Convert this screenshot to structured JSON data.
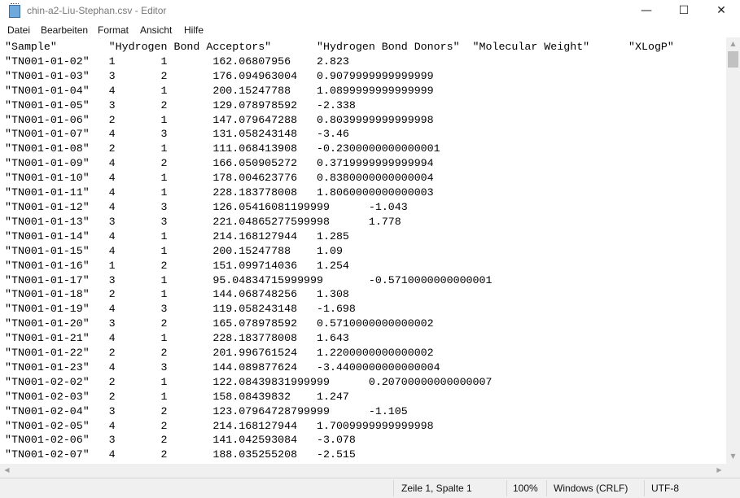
{
  "window": {
    "title": "chin-a2-Liu-Stephan.csv - Editor",
    "controls": {
      "minimize": "—",
      "maximize": "☐",
      "close": "✕"
    }
  },
  "menu": [
    "Datei",
    "Bearbeiten",
    "Format",
    "Ansicht",
    "Hilfe"
  ],
  "document": {
    "header": [
      "\"Sample\"",
      "\"Hydrogen Bond Acceptors\"",
      "\"Hydrogen Bond Donors\"",
      "\"Molecular Weight\"",
      "\"XLogP\""
    ],
    "rows": [
      [
        "\"TN001-01-02\"",
        "1",
        "1",
        "162.06807956",
        "2.823"
      ],
      [
        "\"TN001-01-03\"",
        "3",
        "2",
        "176.094963004",
        "0.9079999999999999"
      ],
      [
        "\"TN001-01-04\"",
        "4",
        "1",
        "200.15247788",
        "1.0899999999999999"
      ],
      [
        "\"TN001-01-05\"",
        "3",
        "2",
        "129.078978592",
        "-2.338"
      ],
      [
        "\"TN001-01-06\"",
        "2",
        "1",
        "147.079647288",
        "0.8039999999999998"
      ],
      [
        "\"TN001-01-07\"",
        "4",
        "3",
        "131.058243148",
        "-3.46"
      ],
      [
        "\"TN001-01-08\"",
        "2",
        "1",
        "111.068413908",
        "-0.2300000000000001"
      ],
      [
        "\"TN001-01-09\"",
        "4",
        "2",
        "166.050905272",
        "0.3719999999999994"
      ],
      [
        "\"TN001-01-10\"",
        "4",
        "1",
        "178.004623776",
        "0.8380000000000004"
      ],
      [
        "\"TN001-01-11\"",
        "4",
        "1",
        "228.183778008",
        "1.8060000000000003"
      ],
      [
        "\"TN001-01-12\"",
        "4",
        "3",
        "126.05416081199999",
        "-1.043"
      ],
      [
        "\"TN001-01-13\"",
        "3",
        "3",
        "221.04865277599998",
        "1.778"
      ],
      [
        "\"TN001-01-14\"",
        "4",
        "1",
        "214.168127944",
        "1.285"
      ],
      [
        "\"TN001-01-15\"",
        "4",
        "1",
        "200.15247788",
        "1.09"
      ],
      [
        "\"TN001-01-16\"",
        "1",
        "2",
        "151.099714036",
        "1.254"
      ],
      [
        "\"TN001-01-17\"",
        "3",
        "1",
        "95.04834715999999",
        "-0.5710000000000001"
      ],
      [
        "\"TN001-01-18\"",
        "2",
        "1",
        "144.068748256",
        "1.308"
      ],
      [
        "\"TN001-01-19\"",
        "4",
        "3",
        "119.058243148",
        "-1.698"
      ],
      [
        "\"TN001-01-20\"",
        "3",
        "2",
        "165.078978592",
        "0.5710000000000002"
      ],
      [
        "\"TN001-01-21\"",
        "4",
        "1",
        "228.183778008",
        "1.643"
      ],
      [
        "\"TN001-01-22\"",
        "2",
        "2",
        "201.996761524",
        "1.2200000000000002"
      ],
      [
        "\"TN001-01-23\"",
        "4",
        "3",
        "144.089877624",
        "-3.4400000000000004"
      ],
      [
        "\"TN001-02-02\"",
        "2",
        "1",
        "122.08439831999999",
        "0.20700000000000007"
      ],
      [
        "\"TN001-02-03\"",
        "2",
        "1",
        "158.08439832",
        "1.247"
      ],
      [
        "\"TN001-02-04\"",
        "3",
        "2",
        "123.07964728799999",
        "-1.105"
      ],
      [
        "\"TN001-02-05\"",
        "4",
        "2",
        "214.168127944",
        "1.7009999999999998"
      ],
      [
        "\"TN001-02-06\"",
        "3",
        "2",
        "141.042593084",
        "-3.078"
      ],
      [
        "\"TN001-02-07\"",
        "4",
        "2",
        "188.035255208",
        "-2.515"
      ]
    ]
  },
  "statusbar": {
    "position": "Zeile 1, Spalte 1",
    "zoom": "100%",
    "line_ending": "Windows (CRLF)",
    "encoding": "UTF-8"
  }
}
